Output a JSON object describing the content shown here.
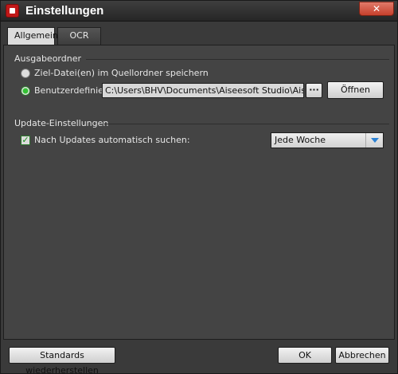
{
  "window": {
    "title": "Einstellungen",
    "close_label": "✕"
  },
  "tabs": [
    {
      "label": "Allgemein",
      "active": true
    },
    {
      "label": "OCR",
      "active": false
    }
  ],
  "output_group": {
    "title": "Ausgabeordner",
    "option_source": "Ziel-Datei(en) im Quellordner speichern",
    "option_custom": "Benutzerdefiniert:",
    "custom_path": "C:\\Users\\BHV\\Documents\\Aiseesoft Studio\\Aiseesoft PDF",
    "browse_label": "···",
    "open_label": "Öffnen",
    "selected": "custom"
  },
  "update_group": {
    "title": "Update-Einstellungen",
    "auto_check_label": "Nach Updates automatisch suchen:",
    "auto_check_enabled": true,
    "interval_value": "Jede Woche"
  },
  "footer": {
    "restore_label": "Standards wiederherstellen",
    "ok_label": "OK",
    "cancel_label": "Abbrechen"
  },
  "colors": {
    "accent_green": "#34c234",
    "close_red": "#c6402c",
    "arrow_blue": "#2c82d4"
  }
}
